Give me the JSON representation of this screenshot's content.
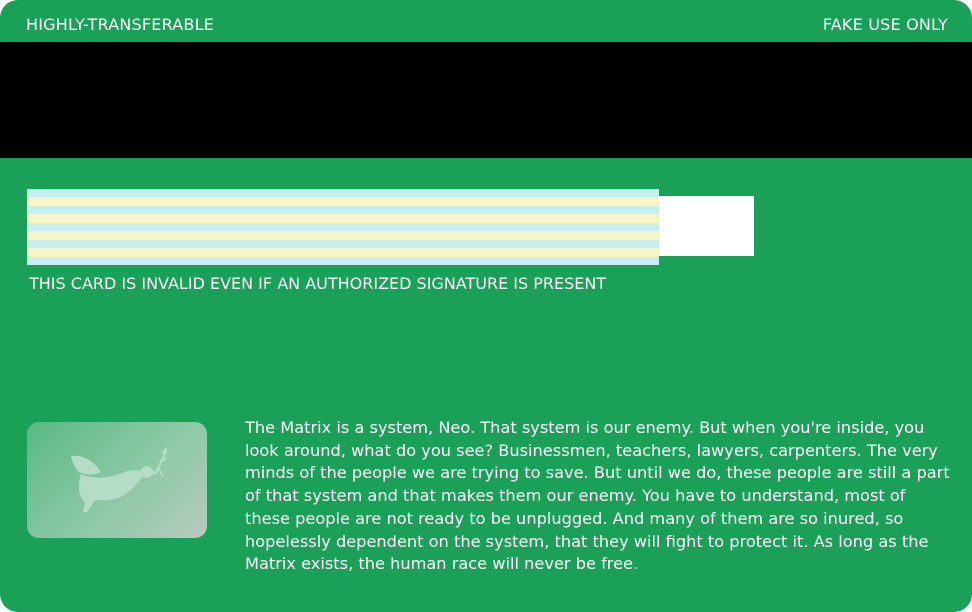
{
  "card": {
    "top_left_label": "HIGHLY-TRANSFERABLE",
    "top_right_label": "FAKE USE ONLY",
    "invalid_notice": "THIS CARD IS INVALID EVEN IF AN AUTHORIZED SIGNATURE IS PRESENT",
    "hologram_icon": "dove-icon",
    "quote_text": "The Matrix is a system, Neo. That system is our enemy. But when you're inside, you look around, what do you see? Businessmen, teachers, lawyers, carpenters. The very minds of the people we are trying to save. But until we do, these people are still a part of that system and that makes them our enemy. You have to understand, most of these people are not ready to be unplugged. And many of them are so inured, so hopelessly dependent on the system, that they will fight to protect it. As long as the Matrix exists, the human race will never be free."
  },
  "colors": {
    "card_background": "#1aa057",
    "magnetic_stripe": "#000000",
    "signature_stripe_blue": "#c8eef0",
    "signature_stripe_yellow": "#f7f5c8"
  }
}
